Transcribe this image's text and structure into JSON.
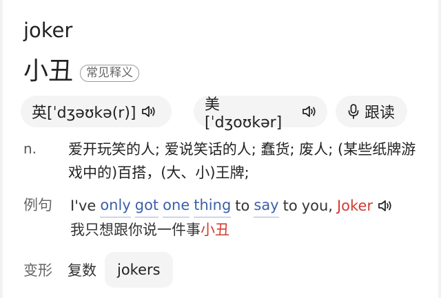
{
  "entry": {
    "headword": "joker",
    "meaning": "小丑",
    "badge": "常见释义"
  },
  "pronunciation": {
    "uk": "英[ˈdʒəʊkə(r)]",
    "us": "美[ˈdʒoʊkər]",
    "follow_read": "跟读",
    "icons": [
      "speaker-icon",
      "microphone-icon"
    ]
  },
  "definition": {
    "pos": "n.",
    "text": "爱开玩笑的人; 爱说笑话的人; 蠢货; 废人; (某些纸牌游戏中的)百搭，(大、小)王牌;"
  },
  "example": {
    "label": "例句",
    "words": [
      "I've",
      "only",
      "got",
      "one",
      "thing",
      "to",
      "say",
      "to",
      "you,",
      "Joker"
    ],
    "underlined_words": [
      "only",
      "got",
      "one",
      "thing",
      "say"
    ],
    "highlight_word": "Joker",
    "translation_prefix": "我只想跟你说一件事",
    "translation_highlight": "小丑"
  },
  "forms": {
    "label": "变形",
    "kind": "复数",
    "value": "jokers"
  },
  "colors": {
    "highlight": "#d23a32",
    "link": "#3b5fa8",
    "pill_bg": "#f4f4f5"
  }
}
